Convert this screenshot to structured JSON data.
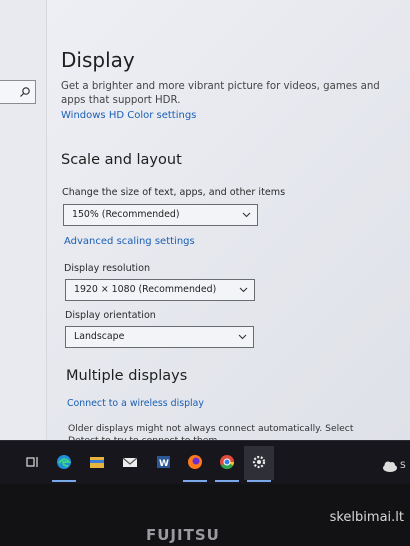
{
  "display": {
    "title": "Display",
    "hdr_description": "Get a brighter and more vibrant picture for videos, games and apps that support HDR.",
    "hdr_link": "Windows HD Color settings"
  },
  "scale_layout": {
    "heading": "Scale and layout",
    "size_label": "Change the size of text, apps, and other items",
    "size_value": "150% (Recommended)",
    "advanced_link": "Advanced scaling settings",
    "resolution_label": "Display resolution",
    "resolution_value": "1920 × 1080 (Recommended)",
    "orientation_label": "Display orientation",
    "orientation_value": "Landscape"
  },
  "multiple": {
    "heading": "Multiple displays",
    "wireless_link": "Connect to a wireless display",
    "older_text": "Older displays might not always connect automatically. Select Detect to try to connect to them."
  },
  "taskbar": {
    "icons": [
      "task-view-icon",
      "edge-icon",
      "file-explorer-icon",
      "mail-icon",
      "word-icon",
      "firefox-icon",
      "chrome-icon",
      "settings-icon"
    ],
    "tray_text": "S",
    "accent": "#7aa8e8"
  },
  "bezel": {
    "brand": "FUJITSU",
    "watermark": "skelbimai.lt"
  },
  "colors": {
    "link": "#1a5fb4",
    "background": "#eef0f6",
    "taskbar": "#17161c"
  }
}
